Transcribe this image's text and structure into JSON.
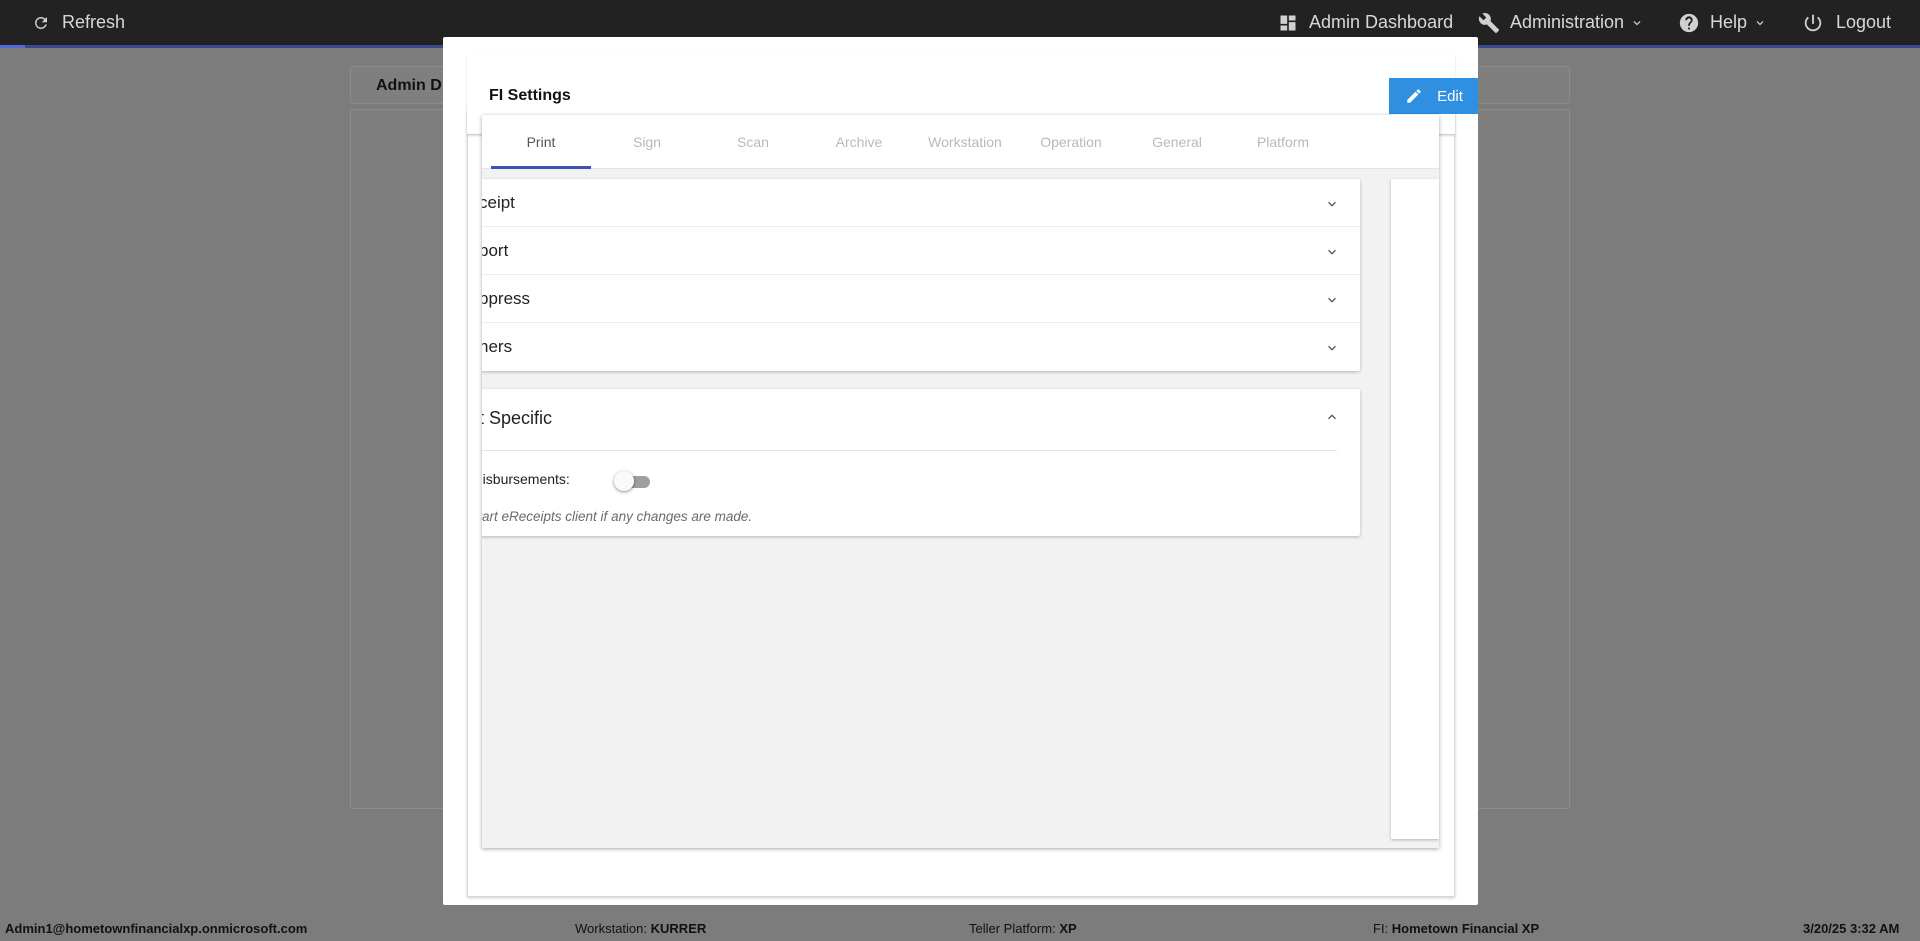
{
  "topbar": {
    "refresh_label": "Refresh",
    "admin_dashboard_label": "Admin Dashboard",
    "administration_label": "Administration",
    "help_label": "Help",
    "logout_label": "Logout"
  },
  "background": {
    "header_title": "Admin D"
  },
  "modal": {
    "title": "FI Settings",
    "edit_label": "Edit",
    "tabs": [
      {
        "label": "Print",
        "active": true
      },
      {
        "label": "Sign"
      },
      {
        "label": "Scan"
      },
      {
        "label": "Archive"
      },
      {
        "label": "Workstation"
      },
      {
        "label": "Operation"
      },
      {
        "label": "General"
      },
      {
        "label": "Platform"
      }
    ],
    "sections": [
      {
        "label": "ceipt"
      },
      {
        "label": "port"
      },
      {
        "label": "ppress"
      },
      {
        "label": "hers"
      }
    ],
    "trust": {
      "title": "st Specific",
      "toggle_label": "nt Disbursements:",
      "toggle_on": false,
      "note": "estart eReceipts client if any changes are made."
    }
  },
  "statusbar": {
    "user": "Admin1@hometownfinancialxp.onmicrosoft.com",
    "workstation_label": "Workstation:",
    "workstation_value": "KURRER",
    "teller_label": "Teller Platform:",
    "teller_value": "XP",
    "fi_label": "FI:",
    "fi_value": "Hometown Financial XP",
    "datetime": "3/20/25 3:32 AM"
  },
  "colors": {
    "accent": "#3f51b5",
    "edit_button": "#2f8fe0",
    "topbar": "#222222",
    "overlay": "#7c7c7c"
  }
}
